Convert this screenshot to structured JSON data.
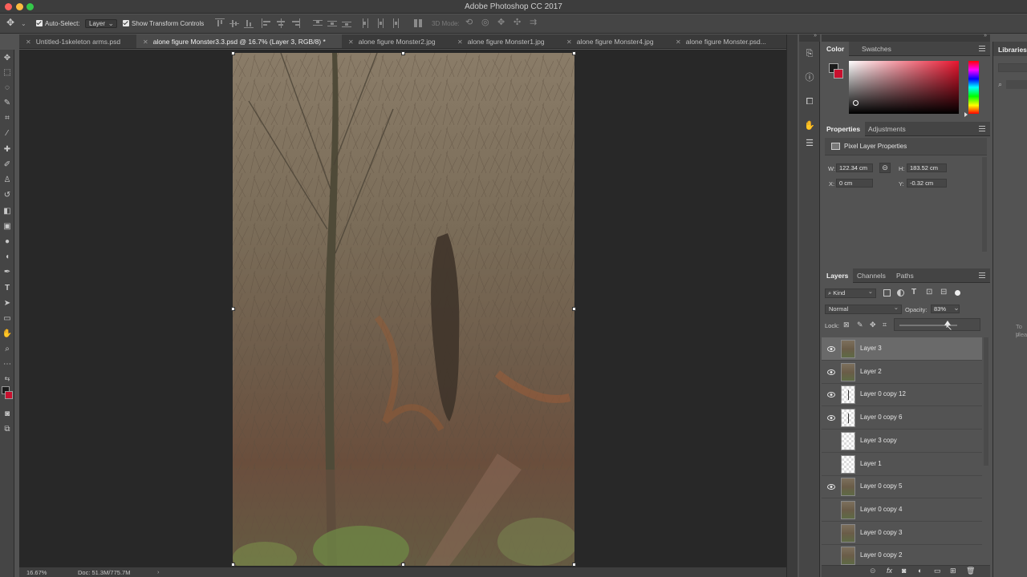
{
  "window": {
    "title": "Adobe Photoshop CC 2017"
  },
  "colors": {
    "close": "#fc605b",
    "minimize": "#fdbc40",
    "zoom": "#34c84a",
    "foreground": "#1b1b1b",
    "background": "#c8102e"
  },
  "options_bar": {
    "auto_select_label": "Auto-Select:",
    "auto_select_value": "Layer",
    "transform_controls_label": "Show Transform Controls",
    "mode_3d_label": "3D Mode:"
  },
  "tabs": [
    {
      "label": "Untitled-1skeleton arms.psd",
      "active": false
    },
    {
      "label": "alone figure Monster3.3.psd @ 16.7% (Layer 3, RGB/8) *",
      "active": true
    },
    {
      "label": "alone figure Monster2.jpg",
      "active": false
    },
    {
      "label": "alone figure Monster1.jpg",
      "active": false
    },
    {
      "label": "alone figure Monster4.jpg",
      "active": false
    },
    {
      "label": "alone figure Monster.psd...",
      "active": false
    }
  ],
  "status": {
    "zoom": "16.67%",
    "doc": "Doc: 51.3M/775.7M"
  },
  "color_panel": {
    "tab_color": "Color",
    "tab_swatches": "Swatches"
  },
  "properties_panel": {
    "tab_properties": "Properties",
    "tab_adjustments": "Adjustments",
    "heading": "Pixel Layer Properties",
    "w_label": "W:",
    "w_value": "122.34 cm",
    "h_label": "H:",
    "h_value": "183.52 cm",
    "x_label": "X:",
    "x_value": "0 cm",
    "y_label": "Y:",
    "y_value": "-0.32 cm"
  },
  "layers_panel": {
    "tab_layers": "Layers",
    "tab_channels": "Channels",
    "tab_paths": "Paths",
    "filter_kind": "Kind",
    "blend_mode": "Normal",
    "opacity_label": "Opacity:",
    "opacity_value": "83%",
    "opacity_fraction": 0.83,
    "lock_label": "Lock:",
    "layers": [
      {
        "name": "Layer 3",
        "visible": true,
        "selected": true,
        "thumb": "photo"
      },
      {
        "name": "Layer 2",
        "visible": true,
        "selected": false,
        "thumb": "photo"
      },
      {
        "name": "Layer 0 copy 12",
        "visible": true,
        "selected": false,
        "thumb": "fig"
      },
      {
        "name": "Layer 0 copy 6",
        "visible": true,
        "selected": false,
        "thumb": "fig"
      },
      {
        "name": "Layer 3 copy",
        "visible": false,
        "selected": false,
        "thumb": "trans"
      },
      {
        "name": "Layer 1",
        "visible": false,
        "selected": false,
        "thumb": "trans"
      },
      {
        "name": "Layer 0 copy 5",
        "visible": true,
        "selected": false,
        "thumb": "photo"
      },
      {
        "name": "Layer 0 copy 4",
        "visible": false,
        "selected": false,
        "thumb": "photo"
      },
      {
        "name": "Layer 0 copy 3",
        "visible": false,
        "selected": false,
        "thumb": "photo"
      },
      {
        "name": "Layer 0 copy 2",
        "visible": false,
        "selected": false,
        "thumb": "photo"
      }
    ]
  },
  "libraries": {
    "title": "Libraries",
    "hint_line1": "To u",
    "hint_line2": "plea"
  }
}
